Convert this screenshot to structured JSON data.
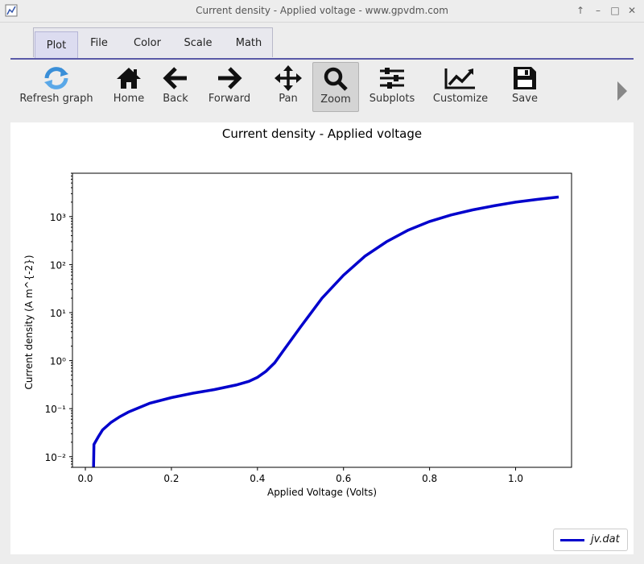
{
  "window": {
    "title": "Current density - Applied voltage - www.gpvdm.com"
  },
  "tabs": [
    {
      "label": "Plot",
      "active": true
    },
    {
      "label": "File",
      "active": false
    },
    {
      "label": "Color",
      "active": false
    },
    {
      "label": "Scale",
      "active": false
    },
    {
      "label": "Math",
      "active": false
    }
  ],
  "toolbar": {
    "refresh": "Refresh graph",
    "home": "Home",
    "back": "Back",
    "forward": "Forward",
    "pan": "Pan",
    "zoom": "Zoom",
    "subplots": "Subplots",
    "customize": "Customize",
    "save": "Save"
  },
  "colors": {
    "line": "#0000cc",
    "tab_underline": "#5a5aa8"
  },
  "chart_data": {
    "type": "line",
    "title": "Current density - Applied voltage",
    "xlabel": "Applied Voltage (Volts)",
    "ylabel": "Current density (A m^{-2})",
    "xlim": [
      -0.03,
      1.13
    ],
    "ylim": [
      0.006,
      8000
    ],
    "yscale": "log",
    "xticks": [
      "0.0",
      "0.2",
      "0.4",
      "0.6",
      "0.8",
      "1.0"
    ],
    "yticks": [
      "10⁻²",
      "10⁻¹",
      "10⁰",
      "10¹",
      "10²",
      "10³"
    ],
    "grid": false,
    "legend_position": "bottom-right",
    "series": [
      {
        "name": "jv.dat",
        "x": [
          0.019,
          0.02,
          0.03,
          0.04,
          0.06,
          0.08,
          0.1,
          0.15,
          0.2,
          0.25,
          0.3,
          0.35,
          0.38,
          0.4,
          0.42,
          0.44,
          0.46,
          0.5,
          0.55,
          0.6,
          0.65,
          0.7,
          0.75,
          0.8,
          0.85,
          0.9,
          0.95,
          1.0,
          1.05,
          1.1
        ],
        "y": [
          0.006,
          0.018,
          0.026,
          0.036,
          0.052,
          0.068,
          0.085,
          0.13,
          0.17,
          0.21,
          0.25,
          0.31,
          0.37,
          0.45,
          0.6,
          0.9,
          1.6,
          5,
          20,
          60,
          150,
          300,
          520,
          790,
          1080,
          1380,
          1680,
          2000,
          2280,
          2560
        ]
      }
    ]
  }
}
